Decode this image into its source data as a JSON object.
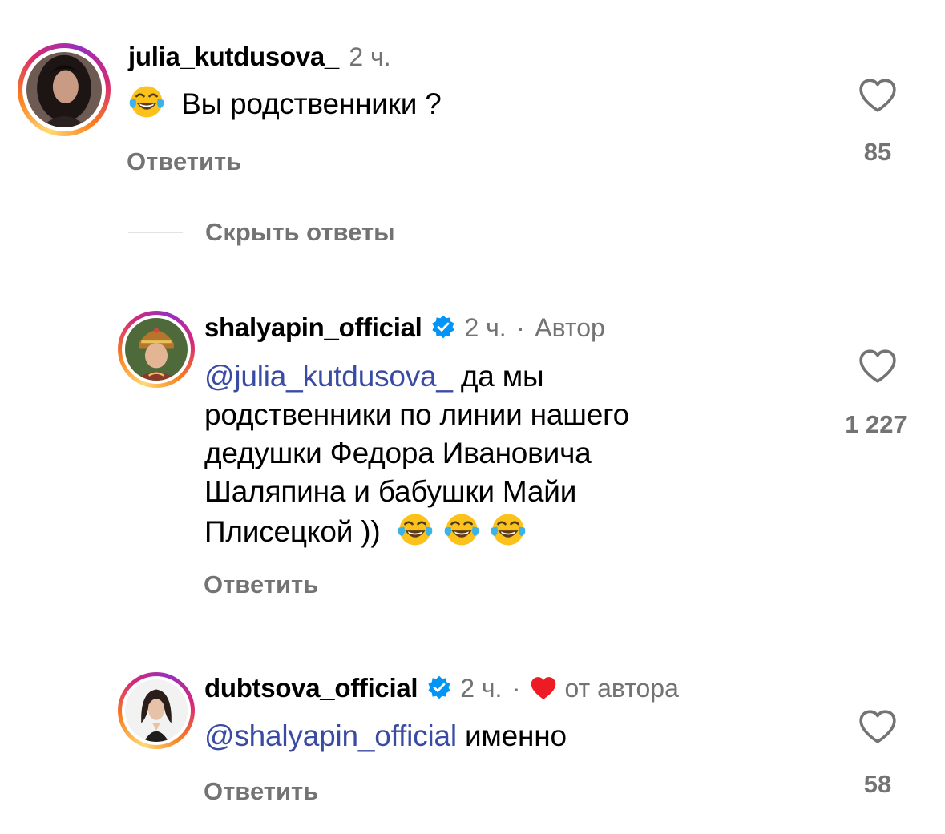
{
  "comments": [
    {
      "username": "julia_kutdusova_",
      "time": "2 ч.",
      "text": "Вы родственники ?",
      "emoji_prefix": "face-with-tears-of-joy",
      "reply_label": "Ответить",
      "likes": "85"
    },
    {
      "username": "shalyapin_official",
      "verified": true,
      "time": "2 ч.",
      "separator": "·",
      "author_tag": "Автор",
      "mention": "@julia_kutdusova_",
      "text_lines": [
        " да мы",
        "родственники по линии нашего",
        "дедушки Федора Ивановича",
        "Шаляпина и бабушки Майи",
        "Плисецкой )) "
      ],
      "emoji_suffix": [
        "face-with-tears-of-joy",
        "face-with-tears-of-joy",
        "face-with-tears-of-joy"
      ],
      "reply_label": "Ответить",
      "likes": "1 227"
    },
    {
      "username": "dubtsova_official",
      "verified": true,
      "time": "2 ч.",
      "separator": "·",
      "liked_by_author": "от автора",
      "mention": "@shalyapin_official",
      "text": " именно",
      "reply_label": "Ответить",
      "likes": "58"
    }
  ],
  "hide_replies_label": "Скрыть ответы",
  "colors": {
    "mention": "#3a4ba3",
    "secondary_text": "#737373",
    "verified_blue": "#0095f6",
    "author_heart": "#ed1c24"
  }
}
